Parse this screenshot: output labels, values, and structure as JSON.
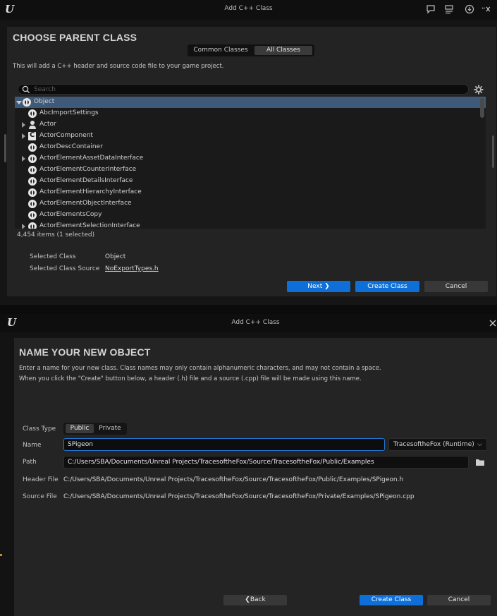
{
  "top_window": {
    "title": "Add C++ Class",
    "heading": "CHOOSE PARENT CLASS",
    "tabs": [
      {
        "label": "Common Classes",
        "active": false
      },
      {
        "label": "All Classes",
        "active": true
      }
    ],
    "description": "This will add a C++ header and source code file to your game project.",
    "search": {
      "placeholder": "Search",
      "value": ""
    },
    "tree_items": [
      {
        "label": "Object",
        "icon": "object-class-icon",
        "expander": "expanded",
        "selected": true,
        "indent": 0
      },
      {
        "label": "AbcImportSettings",
        "icon": "object-class-icon",
        "expander": "none",
        "selected": false,
        "indent": 1
      },
      {
        "label": "Actor",
        "icon": "actor-icon",
        "expander": "collapsed",
        "selected": false,
        "indent": 1
      },
      {
        "label": "ActorComponent",
        "icon": "component-icon",
        "expander": "collapsed",
        "selected": false,
        "indent": 1
      },
      {
        "label": "ActorDescContainer",
        "icon": "object-class-icon",
        "expander": "none",
        "selected": false,
        "indent": 1
      },
      {
        "label": "ActorElementAssetDataInterface",
        "icon": "object-class-icon",
        "expander": "collapsed",
        "selected": false,
        "indent": 1
      },
      {
        "label": "ActorElementCounterInterface",
        "icon": "object-class-icon",
        "expander": "none",
        "selected": false,
        "indent": 1
      },
      {
        "label": "ActorElementDetailsInterface",
        "icon": "object-class-icon",
        "expander": "none",
        "selected": false,
        "indent": 1
      },
      {
        "label": "ActorElementHierarchyInterface",
        "icon": "object-class-icon",
        "expander": "none",
        "selected": false,
        "indent": 1
      },
      {
        "label": "ActorElementObjectInterface",
        "icon": "object-class-icon",
        "expander": "none",
        "selected": false,
        "indent": 1
      },
      {
        "label": "ActorElementsCopy",
        "icon": "object-class-icon",
        "expander": "none",
        "selected": false,
        "indent": 1
      },
      {
        "label": "ActorElementSelectionInterface",
        "icon": "object-class-icon",
        "expander": "collapsed",
        "selected": false,
        "indent": 1
      }
    ],
    "item_count": "4,454 items (1 selected)",
    "selected_class_label": "Selected Class",
    "selected_class_value": "Object",
    "selected_source_label": "Selected Class Source",
    "selected_source_value": "NoExportTypes.h",
    "buttons": {
      "next": "Next",
      "create": "Create Class",
      "cancel": "Cancel"
    }
  },
  "bottom_window": {
    "title": "Add C++ Class",
    "heading": "NAME YOUR NEW OBJECT",
    "description_line1": "Enter a name for your new class. Class names may only contain alphanumeric characters, and may not contain a space.",
    "description_line2": "When you click the \"Create\" button below, a header (.h) file and a source (.cpp) file will be made using this name.",
    "class_type_label": "Class Type",
    "class_type_options": [
      {
        "label": "Public",
        "active": true
      },
      {
        "label": "Private",
        "active": false
      }
    ],
    "name_label": "Name",
    "name_value": "SPigeon",
    "module_value": "TracesoftheFox (Runtime)",
    "path_label": "Path",
    "path_value": "C:/Users/SBA/Documents/Unreal Projects/TracesoftheFox/Source/TracesoftheFox/Public/Examples",
    "header_label": "Header File",
    "header_value": "C:/Users/SBA/Documents/Unreal Projects/TracesoftheFox/Source/TracesoftheFox/Public/Examples/SPigeon.h",
    "source_label": "Source File",
    "source_value": "C:/Users/SBA/Documents/Unreal Projects/TracesoftheFox/Source/TracesoftheFox/Private/Examples/SPigeon.cpp",
    "buttons": {
      "back": "Back",
      "create": "Create Class",
      "cancel": "Cancel"
    }
  },
  "colors": {
    "accent_blue": "#0e6fd8",
    "selection_row": "#3f5a78",
    "panel": "#232323",
    "background": "#151515"
  }
}
